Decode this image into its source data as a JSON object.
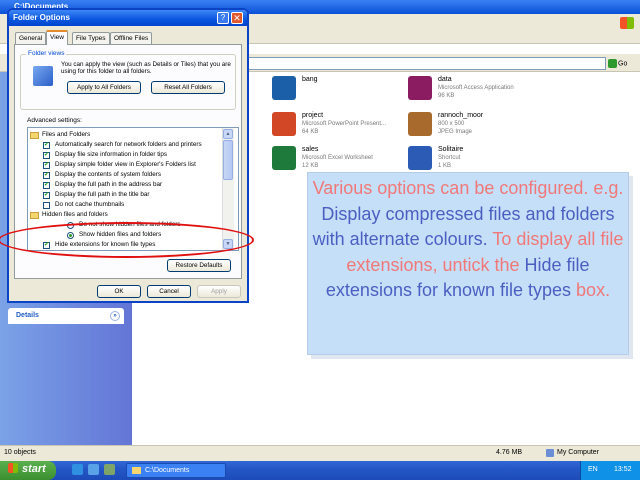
{
  "explorer": {
    "title": "C:\\Documents",
    "address_go": "Go",
    "details_label": "Details",
    "status": {
      "objects": "10 objects",
      "size": "4.76 MB",
      "location": "My Computer"
    },
    "files": [
      {
        "name": "bang",
        "type": "",
        "size": "",
        "icon": "media-player-icon",
        "color": "#1b5fa8"
      },
      {
        "name": "data",
        "type": "Microsoft Access Application",
        "size": "96 KB",
        "icon": "access-icon",
        "color": "#8b1c62"
      },
      {
        "name": "project",
        "type": "Microsoft PowerPoint Present...",
        "size": "64 KB",
        "icon": "powerpoint-icon",
        "color": "#d24726"
      },
      {
        "name": "rannoch_moor",
        "type": "800 x 500",
        "size": "JPEG Image",
        "icon": "image-icon",
        "color": "#a86a2d"
      },
      {
        "name": "sales",
        "type": "Microsoft Excel Worksheet",
        "size": "12 KB",
        "icon": "excel-icon",
        "color": "#1d7a3a"
      },
      {
        "name": "Solitaire",
        "type": "Shortcut",
        "size": "1 KB",
        "icon": "solitaire-icon",
        "color": "#2b5bb5"
      }
    ]
  },
  "taskbar": {
    "start_label": "start",
    "task_label": "C:\\Documents",
    "lang": "EN",
    "time": "13:52"
  },
  "dialog": {
    "title": "Folder Options",
    "help_label": "?",
    "close_label": "✕",
    "tabs": [
      "General",
      "View",
      "File Types",
      "Offline Files"
    ],
    "folder_views": {
      "legend": "Folder views",
      "text": "You can apply the view (such as Details or Tiles) that you are using for this folder to all folders.",
      "apply_label": "Apply to All Folders",
      "reset_label": "Reset All Folders"
    },
    "advanced_label": "Advanced settings:",
    "advanced_items": [
      {
        "kind": "folder",
        "label": "Files and Folders",
        "checked": false
      },
      {
        "kind": "check",
        "label": "Automatically search for network folders and printers",
        "checked": true
      },
      {
        "kind": "check",
        "label": "Display file size information in folder tips",
        "checked": true
      },
      {
        "kind": "check",
        "label": "Display simple folder view in Explorer's Folders list",
        "checked": true
      },
      {
        "kind": "check",
        "label": "Display the contents of system folders",
        "checked": true
      },
      {
        "kind": "check",
        "label": "Display the full path in the address bar",
        "checked": true
      },
      {
        "kind": "check",
        "label": "Display the full path in the title bar",
        "checked": true
      },
      {
        "kind": "check",
        "label": "Do not cache thumbnails",
        "checked": false
      },
      {
        "kind": "folder",
        "label": "Hidden files and folders",
        "checked": false
      },
      {
        "kind": "radio",
        "label": "Do not show hidden files and folders",
        "checked": false
      },
      {
        "kind": "radio",
        "label": "Show hidden files and folders",
        "checked": true
      },
      {
        "kind": "check",
        "label": "Hide extensions for known file types",
        "checked": true
      }
    ],
    "restore_label": "Restore Defaults",
    "ok_label": "OK",
    "cancel_label": "Cancel",
    "apply_label": "Apply"
  },
  "overlay": {
    "p1": "Various options can be configured. e.g. ",
    "p2": "Display compressed files and folders with alternate colours.",
    "p3": " To display all file extensions, untick the ",
    "p4": "Hide file extensions for known file types",
    "p5": " box."
  }
}
